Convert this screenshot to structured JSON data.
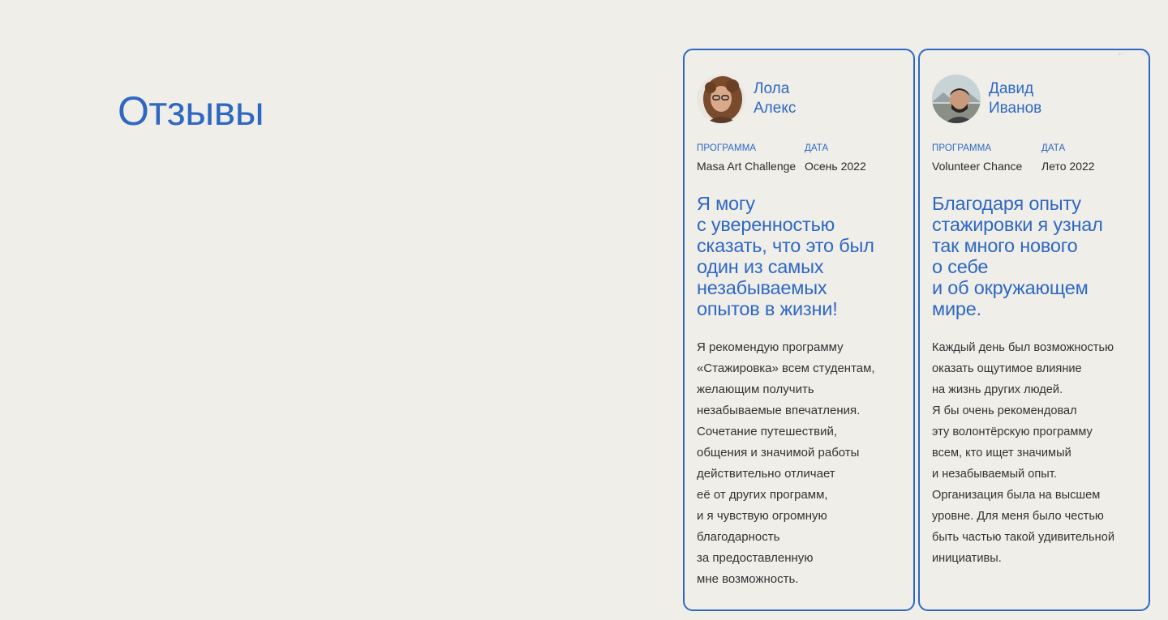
{
  "section": {
    "title": "Отзывы"
  },
  "nav": {
    "prev_icon": "←",
    "next_icon": "→"
  },
  "reviews": [
    {
      "name": "Лола\nАлекс",
      "program_label": "ПРОГРАММА",
      "program": "Masa Art Challenge",
      "date_label": "ДАТА",
      "date": "Осень 2022",
      "quote": "Я могу\nс уверенностью\nсказать, что это был\nодин из самых\nнезабываемых\nопытов в жизни!",
      "text": "Я рекомендую программу\n«Стажировка» всем студентам,\nжелающим получить\nнезабываемые впечатления.\nСочетание путешествий,\nобщения и значимой работы\nдействительно отличает\nеё от других программ,\nи я чувствую огромную\nблагодарность\nза предоставленную\nмне возможность."
    },
    {
      "name": "Давид\nИванов",
      "program_label": "ПРОГРАММА",
      "program": "Volunteer Chance",
      "date_label": "ДАТА",
      "date": "Лето 2022",
      "quote": "Благодаря опыту\nстажировки я узнал\nтак много нового\nо себе\nи об окружающем\nмире.",
      "text": "Каждый день был возможностью\nоказать ощутимое влияние\nна жизнь других людей.\nЯ бы очень рекомендовал\nэту волонтёрскую программу\nвсем, кто ищет значимый\nи незабываемый опыт.\nОрганизация была на высшем\nуровне. Для меня было честью\nбыть частью такой удивительной\nинициативы."
    }
  ],
  "colors": {
    "accent": "#2f68c2",
    "background": "#efeee9"
  }
}
